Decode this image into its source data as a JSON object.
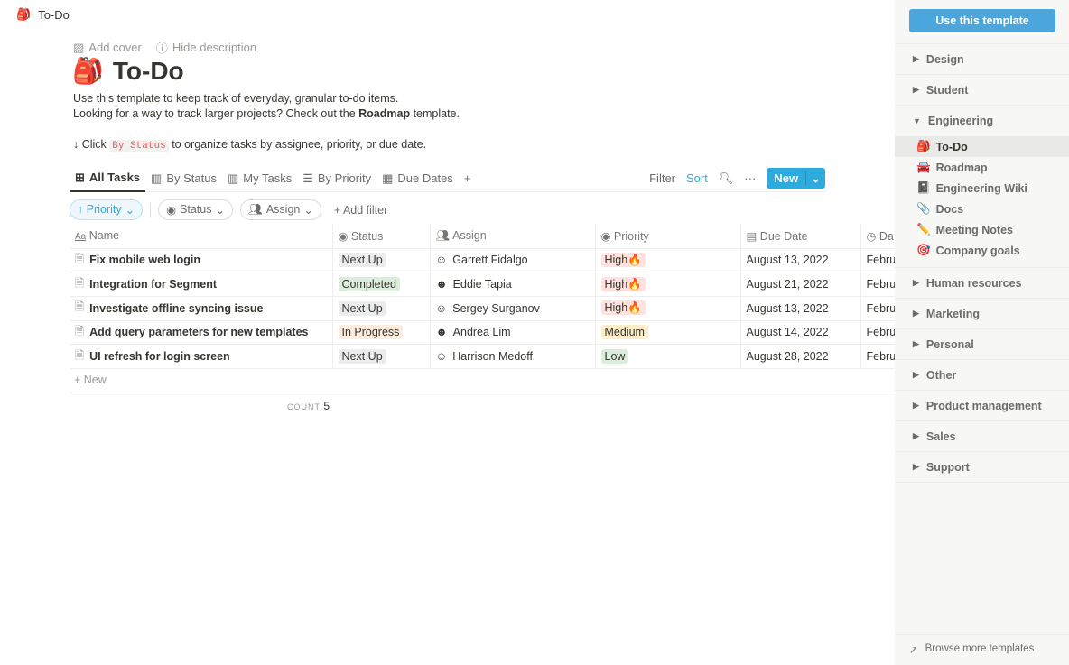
{
  "topbar": {
    "icon": "backpack-icon",
    "title": "To-Do"
  },
  "page": {
    "add_cover": "Add cover",
    "hide_description": "Hide description",
    "emoji": "🎒",
    "title": "To-Do",
    "desc1": "Use this template to keep track of everyday, granular to-do items.",
    "desc2_pre": "Looking for a way to track larger projects? Check out the ",
    "desc2_bold": "Roadmap",
    "desc2_post": " template.",
    "desc3_pre": "↓ Click ",
    "desc3_code": "By Status",
    "desc3_post": " to organize tasks by assignee, priority, or due date."
  },
  "tabs": [
    {
      "label": "All Tasks",
      "icon": "table-icon"
    },
    {
      "label": "By Status",
      "icon": "board-icon"
    },
    {
      "label": "My Tasks",
      "icon": "board-icon"
    },
    {
      "label": "By Priority",
      "icon": "list-icon"
    },
    {
      "label": "Due Dates",
      "icon": "calendar-icon"
    }
  ],
  "toolbar": {
    "filter": "Filter",
    "sort": "Sort",
    "new": "New"
  },
  "filters": {
    "priority": "↑ Priority",
    "status": "Status",
    "assign": "Assign",
    "add": "Add filter"
  },
  "columns": [
    "Name",
    "Status",
    "Assign",
    "Priority",
    "Due Date",
    "Da"
  ],
  "rows": [
    {
      "name": "Fix mobile web login",
      "status": "Next Up",
      "assign": "Garrett Fidalgo",
      "priority": "High🔥",
      "due": "August 13, 2022",
      "date": "Febru"
    },
    {
      "name": "Integration for Segment",
      "status": "Completed",
      "assign": "Eddie Tapia",
      "priority": "High🔥",
      "due": "August 21, 2022",
      "date": "Febru"
    },
    {
      "name": "Investigate offline syncing issue",
      "status": "Next Up",
      "assign": "Sergey Surganov",
      "priority": "High🔥",
      "due": "August 13, 2022",
      "date": "Febru"
    },
    {
      "name": "Add query parameters for new templates",
      "status": "In Progress",
      "assign": "Andrea Lim",
      "priority": "Medium",
      "due": "August 14, 2022",
      "date": "Febru"
    },
    {
      "name": "UI refresh for login screen",
      "status": "Next Up",
      "assign": "Harrison Medoff",
      "priority": "Low",
      "due": "August 28, 2022",
      "date": "Febru"
    }
  ],
  "new_row": "+ New",
  "count": {
    "label": "COUNT",
    "value": "5"
  },
  "colors": {
    "Next Up": "#ebeced",
    "Completed": "#dbeddb",
    "In Progress": "#fbecdd",
    "High🔥": "#ffe2dd",
    "Medium": "#fdecc8",
    "Low": "#dbeddb"
  },
  "sidebar": {
    "use_template": "Use this template",
    "cats_before": [
      "Design",
      "Student"
    ],
    "open_cat": "Engineering",
    "subs": [
      {
        "emoji": "🎒",
        "label": "To-Do"
      },
      {
        "emoji": "🚘",
        "label": "Roadmap"
      },
      {
        "emoji": "📓",
        "label": "Engineering Wiki"
      },
      {
        "emoji": "📎",
        "label": "Docs"
      },
      {
        "emoji": "✏️",
        "label": "Meeting Notes"
      },
      {
        "emoji": "🎯",
        "label": "Company goals"
      }
    ],
    "cats_after": [
      "Human resources",
      "Marketing",
      "Personal",
      "Other",
      "Product management",
      "Sales",
      "Support"
    ],
    "browse": "Browse more templates"
  }
}
